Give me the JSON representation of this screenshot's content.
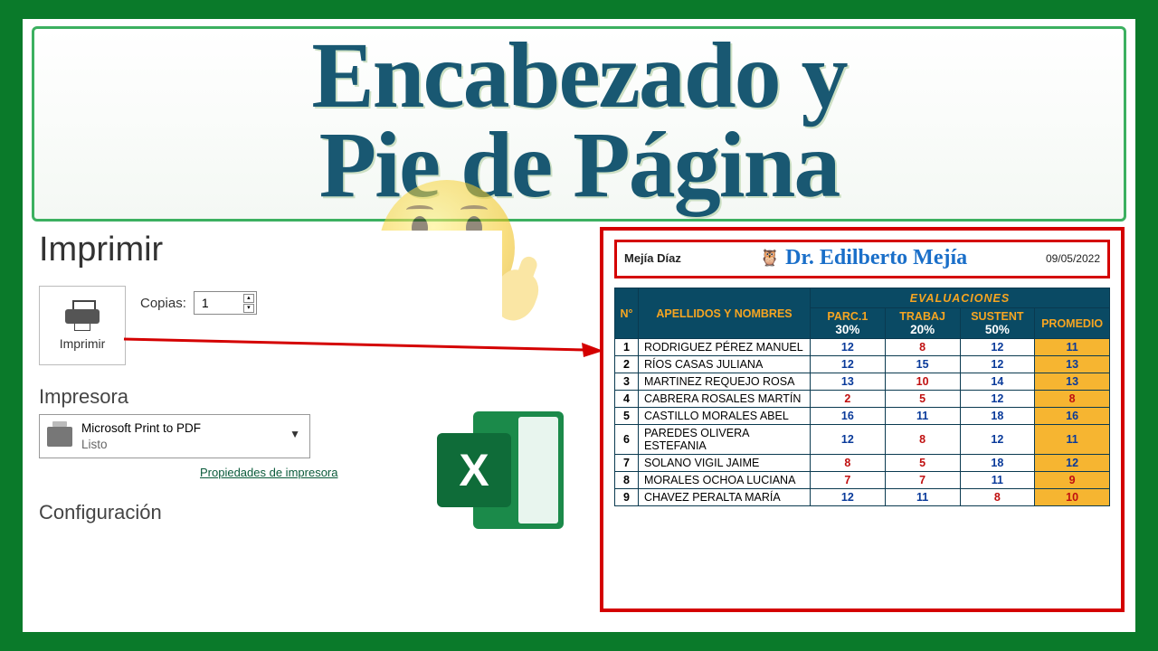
{
  "title": {
    "line1": "Encabezado y",
    "line2": "Pie de Página"
  },
  "print": {
    "heading": "Imprimir",
    "button_label": "Imprimir",
    "copies_label": "Copias:",
    "copies_value": "1",
    "printer_section": "Impresora",
    "printer_name": "Microsoft Print to PDF",
    "printer_status": "Listo",
    "printer_properties": "Propiedades de impresora",
    "config_section": "Configuración"
  },
  "preview": {
    "header_left": "Mejía Díaz",
    "header_center": "Dr. Edilberto Mejía",
    "header_date": "09/05/2022",
    "table": {
      "col_n": "N°",
      "col_names": "APELLIDOS Y NOMBRES",
      "col_eval": "EVALUACIONES",
      "col_parc": "PARC.1",
      "col_trab": "TRABAJ",
      "col_sust": "SUSTENT",
      "col_prom": "PROMEDIO",
      "pct_parc": "30%",
      "pct_trab": "20%",
      "pct_sust": "50%",
      "rows": [
        {
          "n": "1",
          "name": "RODRIGUEZ PÉREZ MANUEL",
          "parc": "12",
          "parc_c": "blue",
          "trab": "8",
          "trab_c": "red",
          "sust": "12",
          "sust_c": "blue",
          "prom": "11",
          "prom_c": "blue"
        },
        {
          "n": "2",
          "name": "RÍOS CASAS JULIANA",
          "parc": "12",
          "parc_c": "blue",
          "trab": "15",
          "trab_c": "blue",
          "sust": "12",
          "sust_c": "blue",
          "prom": "13",
          "prom_c": "blue"
        },
        {
          "n": "3",
          "name": "MARTINEZ REQUEJO ROSA",
          "parc": "13",
          "parc_c": "blue",
          "trab": "10",
          "trab_c": "red",
          "sust": "14",
          "sust_c": "blue",
          "prom": "13",
          "prom_c": "blue"
        },
        {
          "n": "4",
          "name": "CABRERA ROSALES MARTÍN",
          "parc": "2",
          "parc_c": "red",
          "trab": "5",
          "trab_c": "red",
          "sust": "12",
          "sust_c": "blue",
          "prom": "8",
          "prom_c": "red"
        },
        {
          "n": "5",
          "name": "CASTILLO MORALES ABEL",
          "parc": "16",
          "parc_c": "blue",
          "trab": "11",
          "trab_c": "blue",
          "sust": "18",
          "sust_c": "blue",
          "prom": "16",
          "prom_c": "blue"
        },
        {
          "n": "6",
          "name": "PAREDES OLIVERA ESTEFANIA",
          "parc": "12",
          "parc_c": "blue",
          "trab": "8",
          "trab_c": "red",
          "sust": "12",
          "sust_c": "blue",
          "prom": "11",
          "prom_c": "blue"
        },
        {
          "n": "7",
          "name": "SOLANO VIGIL JAIME",
          "parc": "8",
          "parc_c": "red",
          "trab": "5",
          "trab_c": "red",
          "sust": "18",
          "sust_c": "blue",
          "prom": "12",
          "prom_c": "blue"
        },
        {
          "n": "8",
          "name": "MORALES OCHOA LUCIANA",
          "parc": "7",
          "parc_c": "red",
          "trab": "7",
          "trab_c": "red",
          "sust": "11",
          "sust_c": "blue",
          "prom": "9",
          "prom_c": "red"
        },
        {
          "n": "9",
          "name": "CHAVEZ PERALTA MARÍA",
          "parc": "12",
          "parc_c": "blue",
          "trab": "11",
          "trab_c": "blue",
          "sust": "8",
          "sust_c": "red",
          "prom": "10",
          "prom_c": "red"
        }
      ]
    }
  }
}
